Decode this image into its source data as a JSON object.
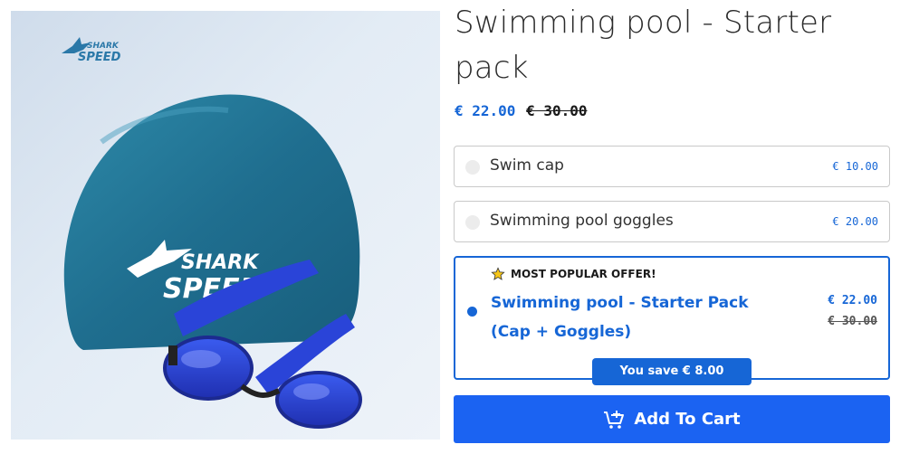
{
  "product": {
    "title": "Swimming pool - Starter pack",
    "price_now": "€ 22.00",
    "price_old": "€ 30.00",
    "brand_logo": {
      "line1": "SHARK",
      "line2": "SPEED"
    },
    "cap_print": {
      "line1": "SHARK",
      "line2": "SPEED"
    }
  },
  "options": [
    {
      "label": "Swim cap",
      "price": "€ 10.00",
      "selected": false
    },
    {
      "label": "Swimming pool goggles",
      "price": "€ 20.00",
      "selected": false
    }
  ],
  "bundle": {
    "badge_icon": "star-icon",
    "badge": "MOST POPULAR OFFER!",
    "label": "Swimming pool - Starter Pack (Cap + Goggles)",
    "price": "€ 22.00",
    "price_old": "€ 30.00",
    "selected": true,
    "save_label": "You save € 8.00"
  },
  "cart": {
    "icon": "cart-add-icon",
    "label": "Add To Cart"
  },
  "colors": {
    "accent": "#1666d6",
    "button": "#1b63f2",
    "cap": "#2e7e9e"
  }
}
